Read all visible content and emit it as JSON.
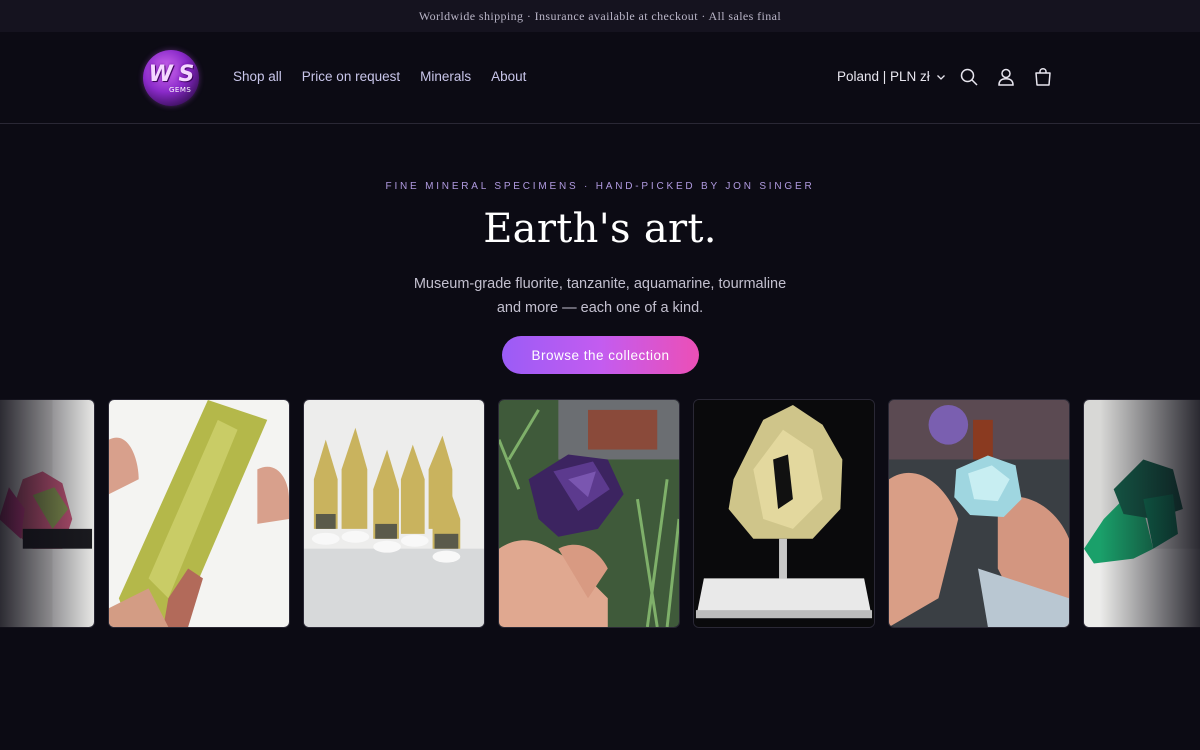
{
  "announcement": "Worldwide shipping · Insurance available at checkout · All sales final",
  "header": {
    "logo_text": "W S",
    "logo_sub": "GEMS",
    "nav": [
      "Shop all",
      "Price on request",
      "Minerals",
      "About"
    ],
    "locale": "Poland | PLN zł"
  },
  "hero": {
    "eyebrow": "FINE MINERAL SPECIMENS · HAND-PICKED BY JON SINGER",
    "title": "Earth's art.",
    "subtitle": "Museum-grade fluorite, tanzanite, aquamarine, tourmaline and more — each one of a kind.",
    "cta": "Browse the collection"
  },
  "gallery": [
    {
      "icon": "pink-mineral-photo"
    },
    {
      "icon": "green-crystal-photo"
    },
    {
      "icon": "citrine-points-photo"
    },
    {
      "icon": "tanzanite-crystal-photo"
    },
    {
      "icon": "golden-slice-photo"
    },
    {
      "icon": "aquamarine-crystal-photo"
    },
    {
      "icon": "green-mineral-photo"
    }
  ],
  "colors": {
    "background": "#0c0b14",
    "accent_start": "#9b5cf6",
    "accent_end": "#ec4fb6",
    "nav_text": "#c9c6ea"
  }
}
